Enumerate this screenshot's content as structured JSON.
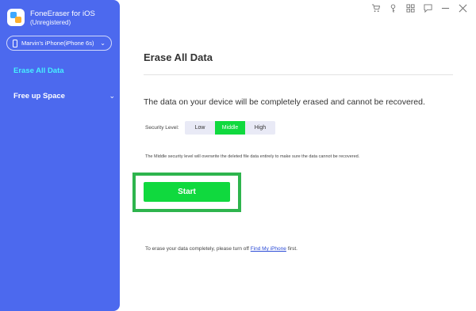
{
  "app": {
    "title": "FoneEraser for iOS",
    "subtitle": "(Unregistered)"
  },
  "device": {
    "name": "Marvin's iPhone(iPhone 6s)"
  },
  "sidebar": {
    "items": [
      {
        "label": "Erase All Data",
        "active": true
      },
      {
        "label": "Free up Space",
        "active": false
      }
    ]
  },
  "window_controls": [
    "cart-icon",
    "key-icon",
    "grid-icon",
    "feedback-icon",
    "minimize-icon",
    "close-icon"
  ],
  "main": {
    "title": "Erase All Data",
    "message": "The data on your device will be completely erased and cannot be recovered.",
    "security_label": "Security Level:",
    "levels": [
      "Low",
      "Middle",
      "High"
    ],
    "selected_level": "Middle",
    "level_note": "The Middle security level will overwrite the deleted file data entirely to make sure the data cannot be recovered.",
    "start_label": "Start",
    "footer_prefix": "To erase your data completely, please turn off ",
    "footer_link": "Find My iPhone",
    "footer_suffix": " first."
  },
  "colors": {
    "sidebar_bg": "#4c69ee",
    "active_nav": "#46f0ff",
    "accent_green": "#10d93e",
    "highlight_border": "#2eb44d"
  }
}
